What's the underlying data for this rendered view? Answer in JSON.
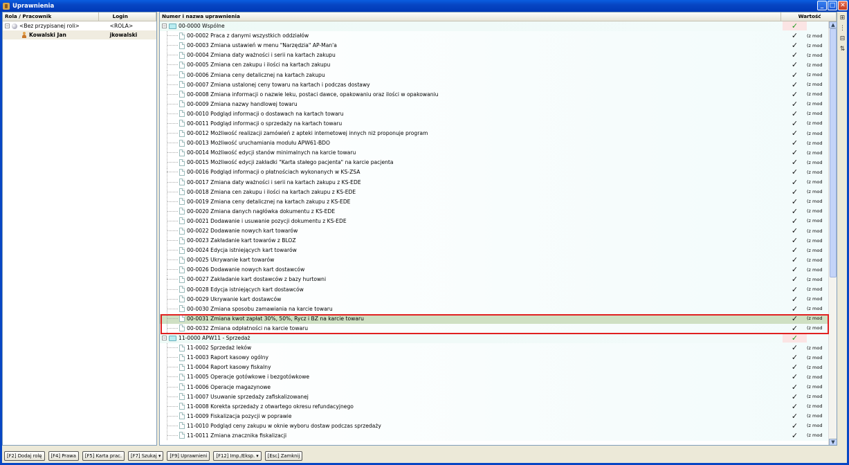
{
  "window": {
    "title": "Uprawnienia"
  },
  "left_header": {
    "col_role": "Rola / Pracownik",
    "col_login": "Login"
  },
  "left_rows": [
    {
      "name": "<Bez przypisanej roli>",
      "login": "<ROLA>"
    },
    {
      "name": "Kowalski Jan",
      "login": "jkowalski"
    }
  ],
  "right_header": {
    "col_name": "Numer i nazwa uprawnienia",
    "col_value": "Wartość"
  },
  "groups": [
    {
      "label": "00-0000  Wspólne",
      "value": "✓",
      "items": [
        {
          "label": "00-0002  Praca z danymi wszystkich oddziałów",
          "value": "✓",
          "note": "(z mod"
        },
        {
          "label": "00-0003  Zmiana ustawień w menu \"Narzędzia\" AP-Man'a",
          "value": "✓",
          "note": "(z mod"
        },
        {
          "label": "00-0004  Zmiana daty ważności i serii na kartach zakupu",
          "value": "✓",
          "note": "(z mod"
        },
        {
          "label": "00-0005  Zmiana cen zakupu i ilości na kartach zakupu",
          "value": "✓",
          "note": "(z mod"
        },
        {
          "label": "00-0006  Zmiana ceny detalicznej na kartach zakupu",
          "value": "✓",
          "note": "(z mod"
        },
        {
          "label": "00-0007  Zmiana ustalonej ceny towaru na kartach i podczas dostawy",
          "value": "✓",
          "note": "(z mod"
        },
        {
          "label": "00-0008  Zmiana informacji o nazwie leku, postaci dawce, opakowaniu oraz ilości w opakowaniu",
          "value": "✓",
          "note": "(z mod"
        },
        {
          "label": "00-0009  Zmiana nazwy handlowej towaru",
          "value": "✓",
          "note": "(z mod"
        },
        {
          "label": "00-0010  Podgląd informacji o dostawach na kartach towaru",
          "value": "✓",
          "note": "(z mod"
        },
        {
          "label": "00-0011  Podgląd informacji o sprzedaży na kartach towaru",
          "value": "✓",
          "note": "(z mod"
        },
        {
          "label": "00-0012  Możliwość realizacji zamówień z apteki internetowej innych niż proponuje program",
          "value": "✓",
          "note": "(z mod"
        },
        {
          "label": "00-0013  Możliwość uruchamiania modułu APW61-BDO",
          "value": "✓",
          "note": "(z mod"
        },
        {
          "label": "00-0014  Możliwość edycji stanów minimalnych na karcie towaru",
          "value": "✓",
          "note": "(z mod"
        },
        {
          "label": "00-0015  Możliwość edycji zakładki \"Karta stałego pacjenta\" na karcie pacjenta",
          "value": "✓",
          "note": "(z mod"
        },
        {
          "label": "00-0016  Podgląd informacji o płatnościach wykonanych w KS-ZSA",
          "value": "✓",
          "note": "(z mod"
        },
        {
          "label": "00-0017  Zmiana daty ważności i serii na kartach zakupu z KS-EDE",
          "value": "✓",
          "note": "(z mod"
        },
        {
          "label": "00-0018  Zmiana cen zakupu i ilości na kartach zakupu z KS-EDE",
          "value": "✓",
          "note": "(z mod"
        },
        {
          "label": "00-0019  Zmiana ceny detalicznej na kartach zakupu z KS-EDE",
          "value": "✓",
          "note": "(z mod"
        },
        {
          "label": "00-0020  Zmiana danych nagłówka dokumentu z KS-EDE",
          "value": "✓",
          "note": "(z mod"
        },
        {
          "label": "00-0021  Dodawanie i usuwanie pozycji dokumentu z KS-EDE",
          "value": "✓",
          "note": "(z mod"
        },
        {
          "label": "00-0022  Dodawanie nowych kart towarów",
          "value": "✓",
          "note": "(z mod"
        },
        {
          "label": "00-0023  Zakładanie kart towarów z BLOZ",
          "value": "✓",
          "note": "(z mod"
        },
        {
          "label": "00-0024  Edycja istniejących kart towarów",
          "value": "✓",
          "note": "(z mod"
        },
        {
          "label": "00-0025  Ukrywanie kart towarów",
          "value": "✓",
          "note": "(z mod"
        },
        {
          "label": "00-0026  Dodawanie nowych kart dostawców",
          "value": "✓",
          "note": "(z mod"
        },
        {
          "label": "00-0027  Zakładanie kart dostawców z bazy hurtowni",
          "value": "✓",
          "note": "(z mod"
        },
        {
          "label": "00-0028  Edycja istniejących kart dostawców",
          "value": "✓",
          "note": "(z mod"
        },
        {
          "label": "00-0029  Ukrywanie kart dostawców",
          "value": "✓",
          "note": "(z mod"
        },
        {
          "label": "00-0030  Zmiana sposobu zamawiania na karcie towaru",
          "value": "✓",
          "note": "(z mod"
        },
        {
          "label": "00-0031  Zmiana kwot zapłat 30%, 50%, Rycz i BZ na karcie towaru",
          "value": "✓",
          "note": "(z mod",
          "highlight": true
        },
        {
          "label": "00-0032  Zmiana odpłatności na karcie towaru",
          "value": "✓",
          "note": "(z mod"
        }
      ]
    },
    {
      "label": "11-0000  APW11 - Sprzedaż",
      "value": "✓",
      "items": [
        {
          "label": "11-0002  Sprzedaż leków",
          "value": "✓",
          "note": "(z mod"
        },
        {
          "label": "11-0003  Raport kasowy ogólny",
          "value": "✓",
          "note": "(z mod"
        },
        {
          "label": "11-0004  Raport kasowy fiskalny",
          "value": "✓",
          "note": "(z mod"
        },
        {
          "label": "11-0005  Operacje gotówkowe i bezgotówkowe",
          "value": "✓",
          "note": "(z mod"
        },
        {
          "label": "11-0006  Operacje magazynowe",
          "value": "✓",
          "note": "(z mod"
        },
        {
          "label": "11-0007  Usuwanie sprzedaży zafiskalizowanej",
          "value": "✓",
          "note": "(z mod"
        },
        {
          "label": "11-0008  Korekta sprzedaży z otwartego okresu refundacyjnego",
          "value": "✓",
          "note": "(z mod"
        },
        {
          "label": "11-0009  Fiskalizacja pozycji w poprawie",
          "value": "✓",
          "note": "(z mod"
        },
        {
          "label": "11-0010  Podgląd ceny zakupu w oknie wyboru dostaw podczas sprzedaży",
          "value": "✓",
          "note": "(z mod"
        },
        {
          "label": "11-0011  Zmiana znacznika fiskalizacji",
          "value": "✓",
          "note": "(z mod"
        }
      ]
    }
  ],
  "buttons": [
    "[F2] Dodaj rolę",
    "[F4] Prawa",
    "[F5] Karta prac.",
    "[F7] Szukaj ▾",
    "[F9] Uprawnieni",
    "[F12] Imp./Eksp. ▾",
    "[Esc] Zamknij"
  ]
}
